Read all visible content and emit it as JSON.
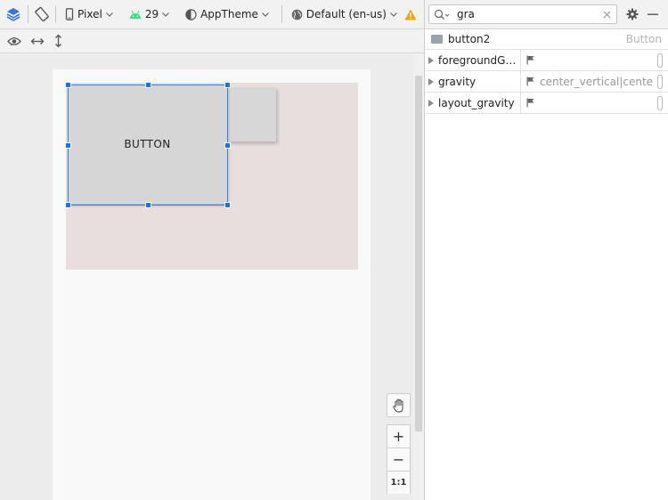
{
  "toolbar": {
    "device": "Pixel",
    "api_level": "29",
    "theme": "AppTheme",
    "locale": "Default (en-us)"
  },
  "canvas": {
    "button_text": "BUTTON",
    "zoom_fit_label": "1:1",
    "zoom_in_label": "+",
    "zoom_out_label": "−"
  },
  "attributes_panel": {
    "search": {
      "value": "gra"
    },
    "component": {
      "name": "button2",
      "type": "Button"
    },
    "rows": [
      {
        "name": "foregroundGravity",
        "value": ""
      },
      {
        "name": "gravity",
        "value": "center_vertical|center_horizontal"
      },
      {
        "name": "layout_gravity",
        "value": ""
      }
    ]
  },
  "colors": {
    "selection": "#1a73e8",
    "android_green": "#3ddc84",
    "warning": "#f0a30a",
    "layers_blue": "#3874d8"
  }
}
